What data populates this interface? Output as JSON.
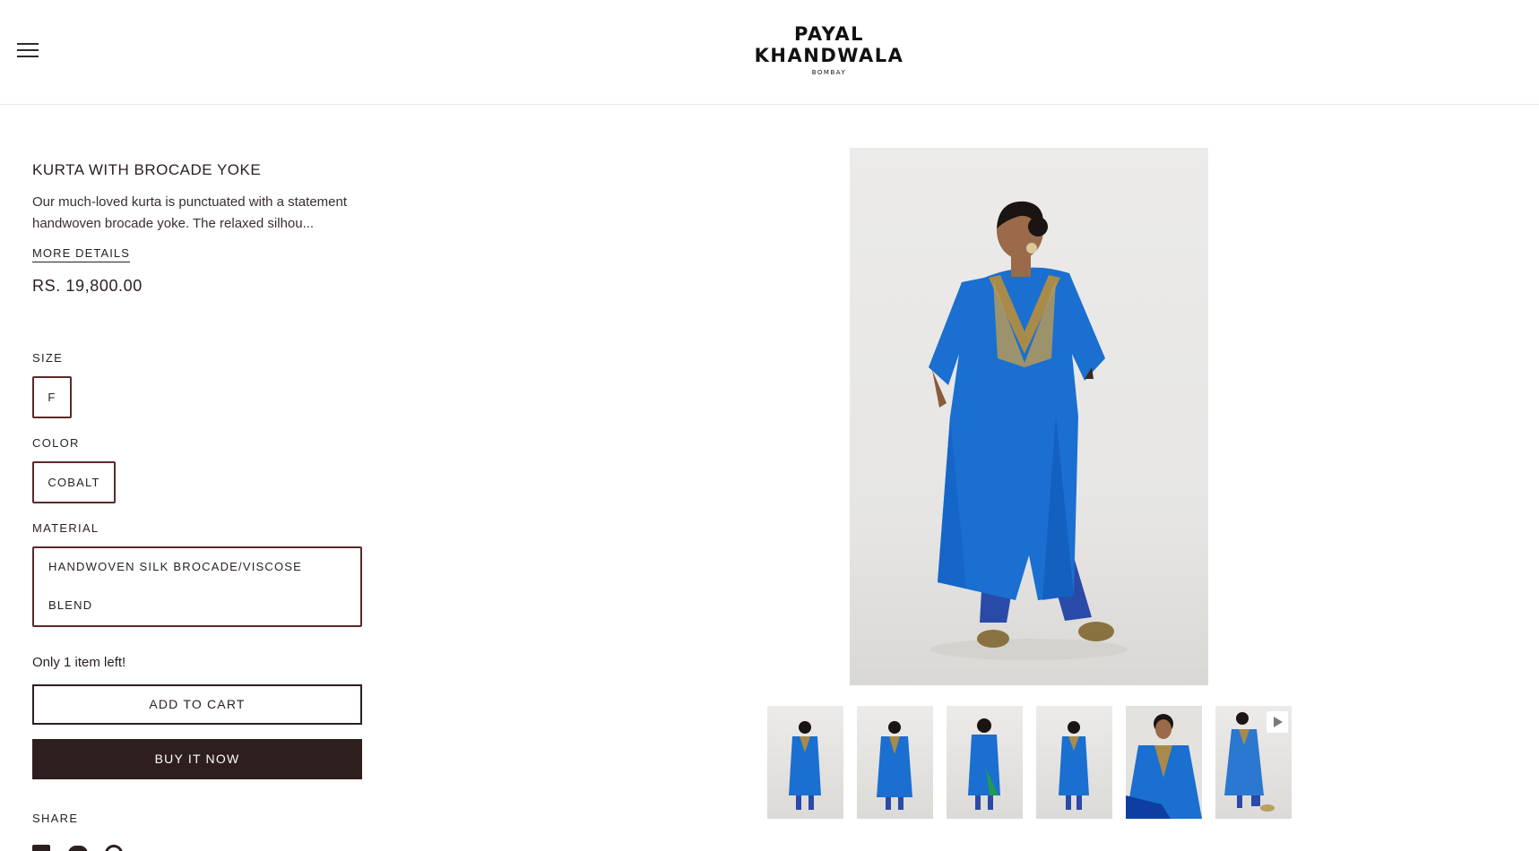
{
  "header": {
    "menu_icon": "hamburger-menu-icon",
    "logo": {
      "line1": "PAYAL",
      "line2": "KHANDWALA",
      "line3": "BOMBAY"
    }
  },
  "product": {
    "title": "KURTA WITH BROCADE YOKE",
    "description": "Our much-loved kurta is punctuated with a statement handwoven brocade yoke. The relaxed silhou...",
    "more_details_label": "MORE DETAILS",
    "price": "RS. 19,800.00",
    "size_label": "SIZE",
    "size_value": "F",
    "color_label": "COLOR",
    "color_value": "COBALT",
    "material_label": "MATERIAL",
    "material_value_line1": "HANDWOVEN SILK BROCADE/VISCOSE",
    "material_value_line2": "BLEND",
    "stock_text": "Only 1 item left!",
    "add_to_cart_label": "ADD TO CART",
    "buy_now_label": "BUY IT NOW",
    "share_label": "SHARE",
    "share_icons": [
      "facebook-icon",
      "twitter-icon",
      "pinterest-icon"
    ]
  },
  "gallery": {
    "thumbnail_count": 6,
    "video_thumbnail_icon": "play-icon"
  },
  "colors": {
    "accent_dark": "#2e1e1e",
    "option_border": "#5a2a2a",
    "garment_blue": "#1a6fd0"
  }
}
